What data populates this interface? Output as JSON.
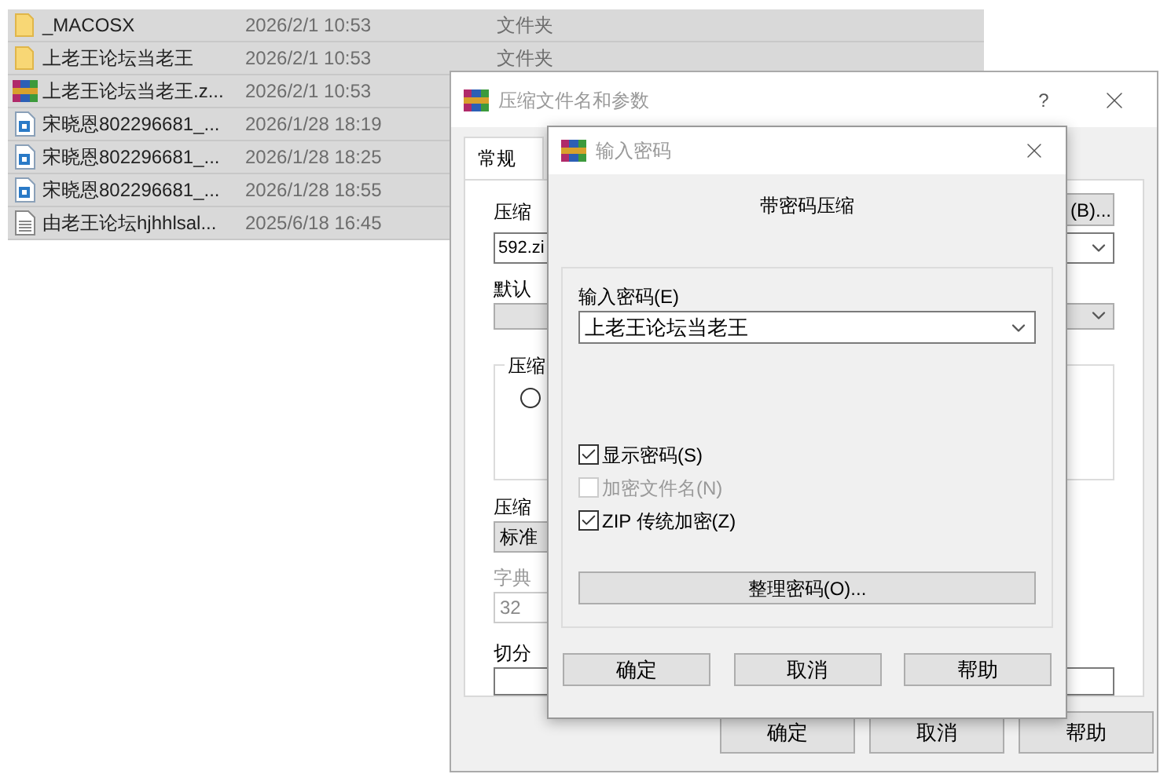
{
  "files": [
    {
      "kind": "folder",
      "name": "_MACOSX",
      "date": "2026/2/1 10:53",
      "type": "文件夹"
    },
    {
      "kind": "folder",
      "name": "上老王论坛当老王",
      "date": "2026/2/1 10:53",
      "type": "文件夹"
    },
    {
      "kind": "archive",
      "name": "上老王论坛当老王.z...",
      "date": "2026/2/1 10:53"
    },
    {
      "kind": "image",
      "name": "宋晓恩802296681_...",
      "date": "2026/1/28 18:19"
    },
    {
      "kind": "image",
      "name": "宋晓恩802296681_...",
      "date": "2026/1/28 18:25"
    },
    {
      "kind": "image",
      "name": "宋晓恩802296681_...",
      "date": "2026/1/28 18:55"
    },
    {
      "kind": "text",
      "name": "由老王论坛hjhhlsal...",
      "date": "2025/6/18 16:45"
    }
  ],
  "back_dialog": {
    "title": "压缩文件名和参数",
    "help": "?",
    "tabs": [
      {
        "label": "常规",
        "selected": true
      }
    ],
    "archive_label": "压缩",
    "browse_button": "(B)...",
    "archive_name": "592.zi",
    "profile_label": "默认",
    "format_group": "压缩",
    "format_radio": {
      "selected": false
    },
    "method_label": "压缩",
    "method_value": "标准",
    "dict_label": "字典",
    "dict_value": "32",
    "split_label": "切分",
    "buttons": [
      "确定",
      "取消",
      "帮助"
    ]
  },
  "password_dialog": {
    "title": "输入密码",
    "heading": "带密码压缩",
    "password_label": "输入密码(E)",
    "password_value": "上老王论坛当老王",
    "options": [
      {
        "label": "显示密码(S)",
        "checked": true,
        "disabled": false
      },
      {
        "label": "加密文件名(N)",
        "checked": false,
        "disabled": true
      },
      {
        "label": "ZIP 传统加密(Z)",
        "checked": true,
        "disabled": false
      }
    ],
    "organize_button": "整理密码(O)...",
    "buttons": [
      "确定",
      "取消",
      "帮助"
    ]
  }
}
